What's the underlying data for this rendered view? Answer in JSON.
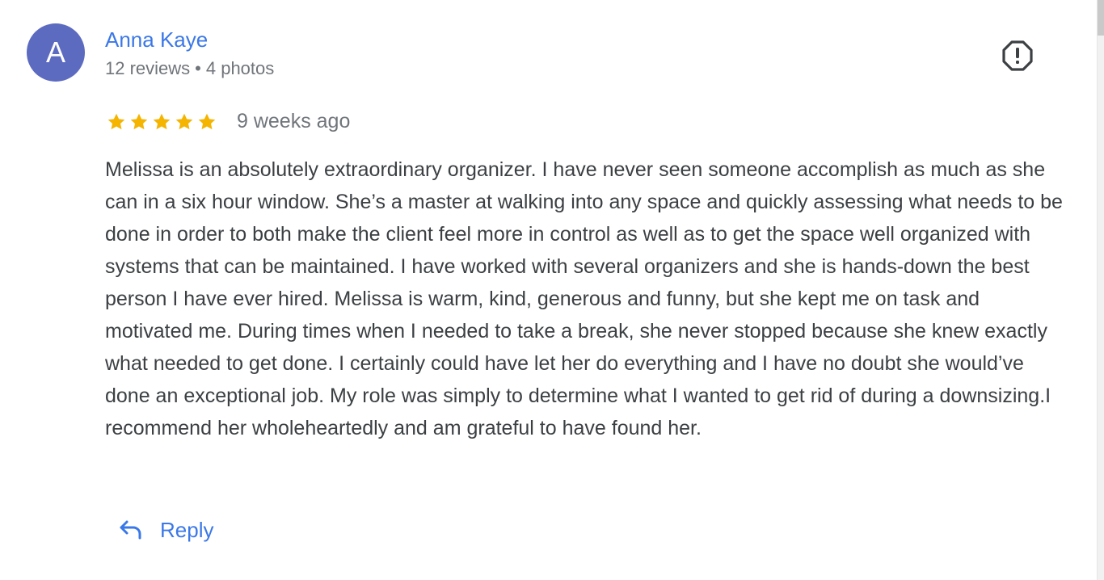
{
  "colors": {
    "avatar_bg": "#5c6bc0",
    "link_blue": "#3b78e7",
    "star_gold": "#f4b400",
    "meta_gray": "#70757a",
    "body_text": "#3c4043"
  },
  "reviewer": {
    "initial": "A",
    "name": "Anna Kaye",
    "reviews_count": "12 reviews",
    "separator": "•",
    "photos_count": "4 photos"
  },
  "actions": {
    "flag_icon": "report-flag-icon",
    "reply_icon": "reply-arrow-icon",
    "reply_label": "Reply"
  },
  "review": {
    "rating": 5,
    "rating_max": 5,
    "date": "9 weeks ago",
    "text": "Melissa is an absolutely extraordinary organizer. I have never seen someone accomplish as much as she can in a six hour window. She’s a master at walking into any space and quickly assessing what needs to be done in order to both make the client feel more in control as well as to get the space well organized with systems that can be maintained. I have worked with several organizers and she is hands-down the best person I have ever hired. Melissa is warm, kind, generous and funny, but she kept me on task and motivated me. During times when I needed to take a break, she never stopped because she knew exactly what needed to get done. I certainly could have let her do everything and I have no doubt she would’ve done an exceptional job. My role was simply to determine what I wanted to get rid of during a downsizing.I recommend her wholeheartedly and am grateful to have found her."
  }
}
